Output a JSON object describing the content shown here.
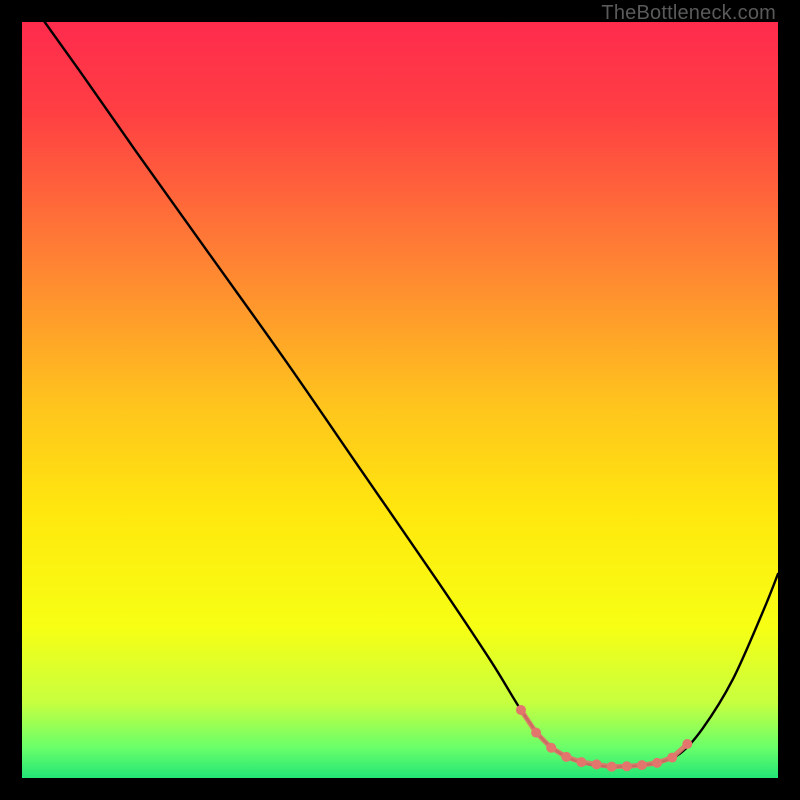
{
  "watermark": "TheBottleneck.com",
  "chart_data": {
    "type": "line",
    "title": "",
    "xlabel": "",
    "ylabel": "",
    "xlim": [
      0,
      100
    ],
    "ylim": [
      0,
      100
    ],
    "gradient_stops": [
      {
        "pos": 0.0,
        "color": "#ff2b4d"
      },
      {
        "pos": 0.12,
        "color": "#ff3f43"
      },
      {
        "pos": 0.3,
        "color": "#ff7d35"
      },
      {
        "pos": 0.5,
        "color": "#ffc21e"
      },
      {
        "pos": 0.65,
        "color": "#ffe80e"
      },
      {
        "pos": 0.8,
        "color": "#f7ff14"
      },
      {
        "pos": 0.9,
        "color": "#c7ff3f"
      },
      {
        "pos": 0.96,
        "color": "#69ff6a"
      },
      {
        "pos": 1.0,
        "color": "#23e575"
      }
    ],
    "series": [
      {
        "name": "bottleneck-curve",
        "x": [
          3,
          8,
          15,
          25,
          35,
          45,
          55,
          62,
          66,
          69,
          72,
          75,
          78,
          81,
          84,
          87,
          90,
          94,
          98,
          100
        ],
        "y": [
          100,
          93,
          83,
          69,
          55,
          40.5,
          26,
          15.5,
          9,
          5,
          2.8,
          1.8,
          1.5,
          1.6,
          2.0,
          3.2,
          6.5,
          13,
          22,
          27
        ]
      }
    ],
    "highlight": {
      "name": "optimal-range",
      "color": "#e2766d",
      "points_x": [
        66,
        68,
        70,
        72,
        74,
        76,
        78,
        80,
        82,
        84,
        86,
        88
      ],
      "points_y": [
        9.0,
        6.0,
        4.0,
        2.8,
        2.1,
        1.8,
        1.5,
        1.55,
        1.7,
        2.0,
        2.7,
        4.5
      ]
    }
  }
}
